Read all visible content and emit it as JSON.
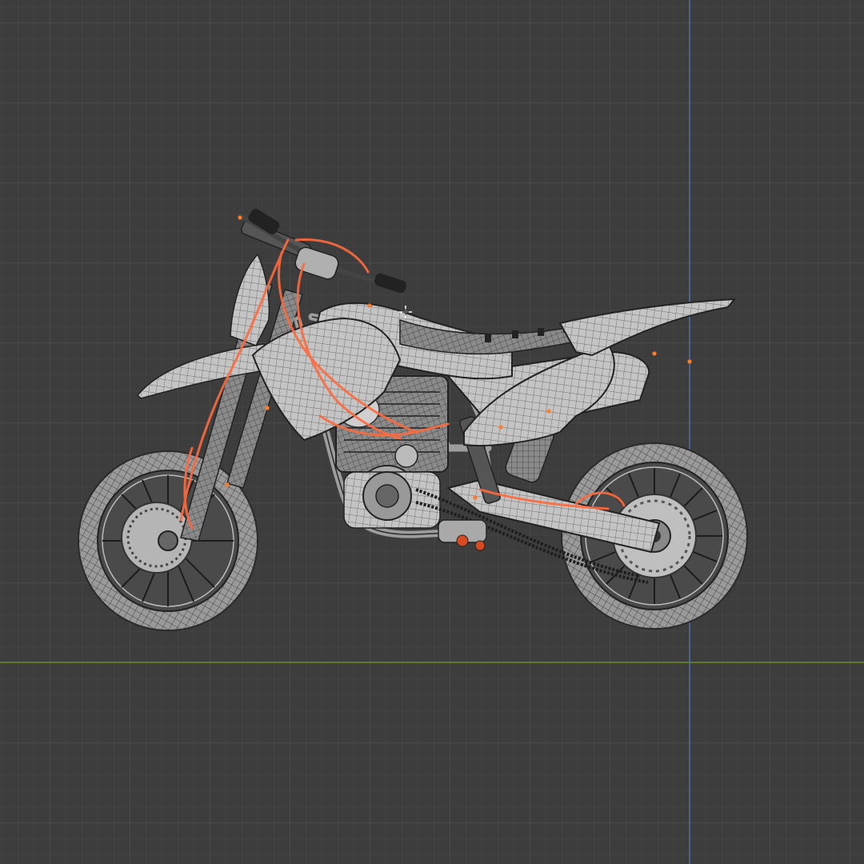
{
  "viewport": {
    "mode": "wireframe",
    "view": "side",
    "grid_visible": true,
    "x_axis_visible": true,
    "z_axis_visible": true
  },
  "colors": {
    "background": "#3d3d3d",
    "grid_minor": "#474747",
    "grid_major": "#505050",
    "x_axis": "#6b8e23",
    "z_axis": "#4a6fa5",
    "mesh_fill": "#bdbdbd",
    "mesh_wire": "#2a2a2a",
    "selection": "#ff6a3d"
  },
  "icons": {
    "cursor": "3d-cursor-icon"
  },
  "scene": {
    "object": "motorcycle-wireframe-mesh",
    "selected_parts": "cable-routing-curves"
  }
}
